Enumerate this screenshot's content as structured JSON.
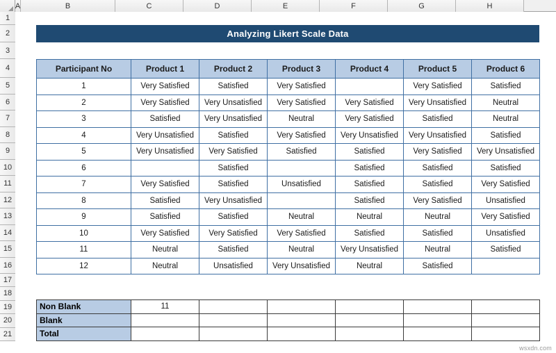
{
  "app": {
    "type": "spreadsheet",
    "watermark": "wsxdn.com"
  },
  "colors": {
    "title_banner_bg": "#1f4a72",
    "header_fill": "#b8cce4",
    "header_border": "#3f6fa3",
    "summary_border": "#3a3a3a",
    "sheet_bg": "#ffffff"
  },
  "grid": {
    "column_letters": [
      "A",
      "B",
      "C",
      "D",
      "E",
      "F",
      "G",
      "H"
    ],
    "row_numbers": [
      "1",
      "2",
      "3",
      "4",
      "5",
      "6",
      "7",
      "8",
      "9",
      "10",
      "11",
      "12",
      "13",
      "14",
      "15",
      "16",
      "17",
      "18",
      "19",
      "20",
      "21"
    ]
  },
  "title": {
    "text": "Analyzing Likert Scale Data"
  },
  "table": {
    "headers": [
      "Participant No",
      "Product 1",
      "Product 2",
      "Product 3",
      "Product 4",
      "Product 5",
      "Product 6"
    ],
    "rows": [
      [
        "1",
        "Very Satisfied",
        "Satisfied",
        "Very Satisfied",
        "",
        "Very Satisfied",
        "Satisfied"
      ],
      [
        "2",
        "Very Satisfied",
        "Very Unsatisfied",
        "Very Satisfied",
        "Very Satisfied",
        "Very Unsatisfied",
        "Neutral"
      ],
      [
        "3",
        "Satisfied",
        "Very Unsatisfied",
        "Neutral",
        "Very Satisfied",
        "Satisfied",
        "Neutral"
      ],
      [
        "4",
        "Very Unsatisfied",
        "Satisfied",
        "Very Satisfied",
        "Very Unsatisfied",
        "Very Unsatisfied",
        "Satisfied"
      ],
      [
        "5",
        "Very Unsatisfied",
        "Very Satisfied",
        "Satisfied",
        "Satisfied",
        "Very Satisfied",
        "Very Unsatisfied"
      ],
      [
        "6",
        "",
        "Satisfied",
        "",
        "Satisfied",
        "Satisfied",
        "Satisfied"
      ],
      [
        "7",
        "Very Satisfied",
        "Satisfied",
        "Unsatisfied",
        "Satisfied",
        "Satisfied",
        "Very Satisfied"
      ],
      [
        "8",
        "Satisfied",
        "Very Unsatisfied",
        "",
        "Satisfied",
        "Very Satisfied",
        "Unsatisfied"
      ],
      [
        "9",
        "Satisfied",
        "Satisfied",
        "Neutral",
        "Neutral",
        "Neutral",
        "Very Satisfied"
      ],
      [
        "10",
        "Very Satisfied",
        "Very Satisfied",
        "Very Satisfied",
        "Satisfied",
        "Satisfied",
        "Unsatisfied"
      ],
      [
        "11",
        "Neutral",
        "Satisfied",
        "Neutral",
        "Very Unsatisfied",
        "Neutral",
        "Satisfied"
      ],
      [
        "12",
        "Neutral",
        "Unsatisfied",
        "Very Unsatisfied",
        "Neutral",
        "Satisfied",
        ""
      ]
    ]
  },
  "summary": {
    "rows": [
      {
        "label": "Non Blank",
        "values": [
          "11",
          "",
          "",
          "",
          "",
          ""
        ]
      },
      {
        "label": "Blank",
        "values": [
          "",
          "",
          "",
          "",
          "",
          ""
        ]
      },
      {
        "label": "Total",
        "values": [
          "",
          "",
          "",
          "",
          "",
          ""
        ]
      }
    ]
  }
}
